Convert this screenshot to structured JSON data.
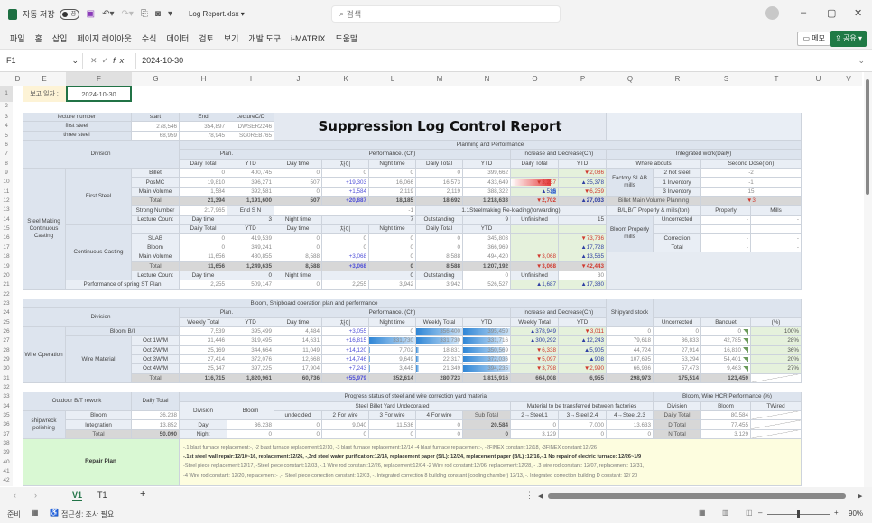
{
  "app": {
    "autosave_label": "자동 저장",
    "autosave_state": "끔",
    "file_name": "Log Report.xlsx ▾",
    "search_placeholder": "검색",
    "ribbon_tabs": [
      "파일",
      "홈",
      "삽입",
      "페이지 레이아웃",
      "수식",
      "데이터",
      "검토",
      "보기",
      "개발 도구",
      "i-MATRIX",
      "도움말"
    ],
    "memo_button": "메모",
    "share_button": "공유 ▾",
    "name_box": "F1",
    "formula": "2024-10-30",
    "columns": [
      "D",
      "E",
      "F",
      "G",
      "H",
      "I",
      "J",
      "K",
      "L",
      "M",
      "N",
      "O",
      "P",
      "Q",
      "R",
      "S",
      "T",
      "U",
      "V"
    ],
    "selected_column": "F",
    "row_numbers": [
      1,
      2,
      3,
      4,
      5,
      6,
      7,
      8,
      9,
      10,
      11,
      12,
      13,
      14,
      15,
      16,
      17,
      18,
      19,
      20,
      21,
      22,
      23,
      24,
      25,
      26,
      27,
      28,
      29,
      30,
      31,
      32,
      33,
      34,
      35,
      36,
      37,
      38,
      39,
      40,
      41,
      42
    ],
    "sheet_tabs": [
      "V1",
      "T1"
    ],
    "active_sheet": "V1",
    "status_ready": "준비",
    "accessibility": "접근성: 조사 필요",
    "zoom": "90%"
  },
  "header": {
    "report_date_label": "보고 일자 :",
    "report_date": "2024-10-30"
  },
  "s1": {
    "lecture": {
      "headers": [
        "lecture number",
        "start",
        "End",
        "LectureC/D"
      ],
      "rows": [
        [
          "first steel",
          "278,546",
          "354,897",
          "DWSER2246"
        ],
        [
          "three steel",
          "68,959",
          "78,945",
          "SG0REB765"
        ]
      ]
    },
    "title": "Suppression Log Control Report",
    "division": "Division",
    "planning": "Planning and Performance",
    "plan": "Plan.",
    "performance": "Performance. (Ch)",
    "incdec": "Increase and Decrease(Ch)",
    "integrated": "Integrated work(Daily)",
    "col_headers": [
      "Daily Total",
      "YTD",
      "Day time",
      "차이",
      "Night time",
      "Daily Total",
      "YTD",
      "Daily Total",
      "YTD"
    ],
    "where": "Where abouts",
    "second_dose": "Second Dose(ton)",
    "group": "Steel Making Continuous Casting",
    "first_steel": {
      "label": "First Steel",
      "rows": [
        {
          "label": "Billet",
          "values": [
            "0",
            "400,745",
            "0",
            "0",
            "0",
            "0",
            "399,662",
            "",
            "▼2,086"
          ]
        },
        {
          "label": "PosMC",
          "values": [
            "19,810",
            "396,271",
            "507",
            "+19,303",
            "16,066",
            "16,573",
            "433,649",
            "▼3,237",
            "▲35,378"
          ]
        },
        {
          "label": "Main Volume",
          "values": [
            "1,584",
            "392,581",
            "0",
            "+1,584",
            "2,119",
            "2,119",
            "388,322",
            "▲535",
            "▼6,259"
          ]
        },
        {
          "label": "Total",
          "values": [
            "21,394",
            "1,191,600",
            "507",
            "+20,887",
            "18,185",
            "18,692",
            "1,218,633",
            "▼2,702",
            "▲27,033"
          ]
        }
      ],
      "strong": {
        "label": "Strong Number",
        "value": "217,965",
        "end_label": "End S N",
        "end_value": "-1"
      },
      "lecture_count": [
        "Lecture Count",
        "Day time",
        "3",
        "Night time",
        "7",
        "Outstanding",
        "9",
        "Unfinished",
        "15"
      ]
    },
    "reloading": "1.1Steelmaking Re-loading(forwarding)",
    "cc": {
      "label": "Continuous Casting",
      "headers": [
        "Daily Total",
        "YTD",
        "Day time",
        "차이",
        "Night time",
        "Daily Total",
        "YTD"
      ],
      "rows": [
        {
          "label": "SLAB",
          "values": [
            "0",
            "419,539",
            "0",
            "0",
            "0",
            "0",
            "345,803",
            "",
            "▼73,736"
          ]
        },
        {
          "label": "Bloom",
          "values": [
            "0",
            "349,241",
            "0",
            "0",
            "0",
            "0",
            "366,969",
            "",
            "▲17,728"
          ]
        },
        {
          "label": "Main Volume",
          "values": [
            "11,656",
            "480,855",
            "8,588",
            "+3,068",
            "0",
            "8,588",
            "494,420",
            "▼3,068",
            "▲13,565"
          ]
        },
        {
          "label": "Total",
          "values": [
            "11,656",
            "1,249,635",
            "8,588",
            "+3,068",
            "0",
            "8,588",
            "1,207,192",
            "▼3,068",
            "▼42,443"
          ]
        }
      ],
      "lecture_count": [
        "Lecture Count",
        "Day time",
        "0",
        "Night time",
        "0",
        "Outstanding",
        "0",
        "Unfinished",
        "30"
      ]
    },
    "spring": {
      "label": "Performance of spring ST Plan",
      "values": [
        "2,255",
        "509,147",
        "0",
        "2,255",
        "3,942",
        "3,942",
        "526,527",
        "▲1,687",
        "▲17,380"
      ]
    },
    "factory": {
      "label": "Factory SLAB mills",
      "rows": [
        [
          "2 hot steel",
          "-2"
        ],
        [
          "1 Inventory",
          "-1"
        ],
        [
          "3 Inventory",
          "15"
        ]
      ]
    },
    "billet_plan": {
      "label": "Billet Main Volume Planning",
      "value": "▼3"
    },
    "bbt": {
      "label": "B/L,B/T Properly & mills(ton)",
      "properly": "Properly",
      "mills": "Mills"
    },
    "bloom_mills": {
      "label": "Bloom Properly mills",
      "rows": [
        [
          "Uncorrected",
          "-",
          "-"
        ],
        [
          "",
          "",
          ""
        ],
        [
          "Correction",
          "-",
          "-"
        ],
        [
          "Total",
          "-",
          "-"
        ]
      ]
    }
  },
  "s2": {
    "title": "Bloom, Shipboard operation plan and performance",
    "shipyard": "Shipyard stock",
    "division": "Division",
    "plan": "Plan.",
    "performance": "Performance. (Ch)",
    "incdec": "Increase and Decrease(Ch)",
    "col_headers": [
      "Weekly Total",
      "YTD",
      "Day time",
      "차이",
      "Night time",
      "Weekly Total",
      "YTD",
      "Weekly Total",
      "YTD"
    ],
    "right_headers": [
      "Uncorrected",
      "Banquet",
      "(%)"
    ],
    "group": "Wire Operation",
    "bloom_bi": {
      "label": "Bloom B/I",
      "values": [
        "7,539",
        "395,499",
        "4,484",
        "+3,055",
        "0",
        "356,400",
        "395,459",
        "▲378,949",
        "▼3,011",
        "0",
        "0",
        "0",
        "100%"
      ]
    },
    "wire_material": {
      "label": "Wire Material",
      "rows": [
        {
          "label": "Oct 1W/M",
          "values": [
            "31,446",
            "319,495",
            "14,631",
            "+16,815",
            "331,730",
            "331,730",
            "331,716",
            "▲300,292",
            "▲12,243",
            "79,618",
            "36,833",
            "42,785",
            "28%"
          ]
        },
        {
          "label": "Oct 2W/M",
          "values": [
            "25,169",
            "344,664",
            "11,049",
            "+14,120",
            "7,702",
            "18,831",
            "350,569",
            "▼6,338",
            "▲5,905",
            "44,724",
            "27,914",
            "16,810",
            "36%"
          ]
        },
        {
          "label": "Oct 3W/M",
          "values": [
            "27,414",
            "372,076",
            "12,668",
            "+14,746",
            "9,649",
            "22,317",
            "372,036",
            "▼5,097",
            "▲908",
            "107,695",
            "53,294",
            "54,401",
            "20%"
          ]
        },
        {
          "label": "Oct 4W/M",
          "values": [
            "25,147",
            "397,225",
            "17,904",
            "+7,243",
            "3,445",
            "21,349",
            "394,235",
            "▼3,798",
            "▼2,990",
            "66,936",
            "57,473",
            "9,463",
            "27%"
          ]
        },
        {
          "label": "Total",
          "values": [
            "116,715",
            "1,820,961",
            "60,736",
            "+55,979",
            "352,614",
            "280,723",
            "1,815,916",
            "664,008",
            "6,955",
            "298,973",
            "175,514",
            "123,459"
          ]
        }
      ]
    }
  },
  "s3": {
    "outdoor": "Outdoor B/T rework",
    "daily_total": "Daily Total",
    "progress": "Progress status of steel and wire correction yard material",
    "hcr": "Bloom, Wire HCR Performance (%)",
    "division": "Division",
    "bloom": "Bloom",
    "billet_yard": "Steel Billet Yard Undecorated",
    "transfer": "Material to be transferred between factories",
    "hcr_headers": [
      "Division",
      "Bloom",
      "TWired"
    ],
    "yard_headers": [
      "undecided",
      "2 For wire",
      "3 For wire",
      "4 For wire",
      "Sub Total",
      "2→Steel,1",
      "3→Steel,2,4",
      "4→Steel,2,3"
    ],
    "shipwreck": "shipwreck polishing",
    "rework_rows": [
      [
        "Bloom",
        "36,238"
      ],
      [
        "Integration",
        "13,852"
      ],
      [
        "Total",
        "50,090"
      ]
    ],
    "yard_rows": [
      {
        "label": "Day",
        "values": [
          "36,238",
          "0",
          "9,040",
          "11,536",
          "0",
          "20,584",
          "0",
          "7,000",
          "13,633"
        ]
      },
      {
        "label": "Night",
        "values": [
          "0",
          "0",
          "0",
          "0",
          "0",
          "0",
          "3,129",
          "0",
          "0"
        ]
      }
    ],
    "hcr_rows": [
      [
        "Daily Total",
        "80,584"
      ],
      [
        "D.Total",
        "77,455"
      ],
      [
        "N.Total",
        "3,129"
      ]
    ],
    "repair_label": "Repair Plan",
    "repair_lines": [
      "-.1 blast furnace replacement:-, -2 blast furnace replacement:12/10, -3 blast furnace replacement:12/14 -4 blast furnace replacement:-, -2FINEX constant:12/18, -3FINEX constant:12 /26",
      "-.1st steel wall repair:12/10~16, replacement:12/26, -,3rd steel water purification:12/14, replacement paper (S/L): 12/24, replacement paper (B/L) :12/16,-.1 No repair of electric furnace: 12/26~1/9",
      "-Steel piece replacement:12/17, -Steel piece constant:12/03, -.1 Wire rod constant:12/26, replacement:12/04 -2 Wire rod constant:12/06, replacement:12/28, - .3 wire rod constant: 12/07, replacement: 12/31,",
      "-4 Wire rod constant: 12/20, replacement:- ,-. Steel piece correction constant: 12/03, -. Integrated correction 8 building constant (cooling chamber) 12/13, -. Integrated correction building D constant: 12/ 20"
    ]
  }
}
